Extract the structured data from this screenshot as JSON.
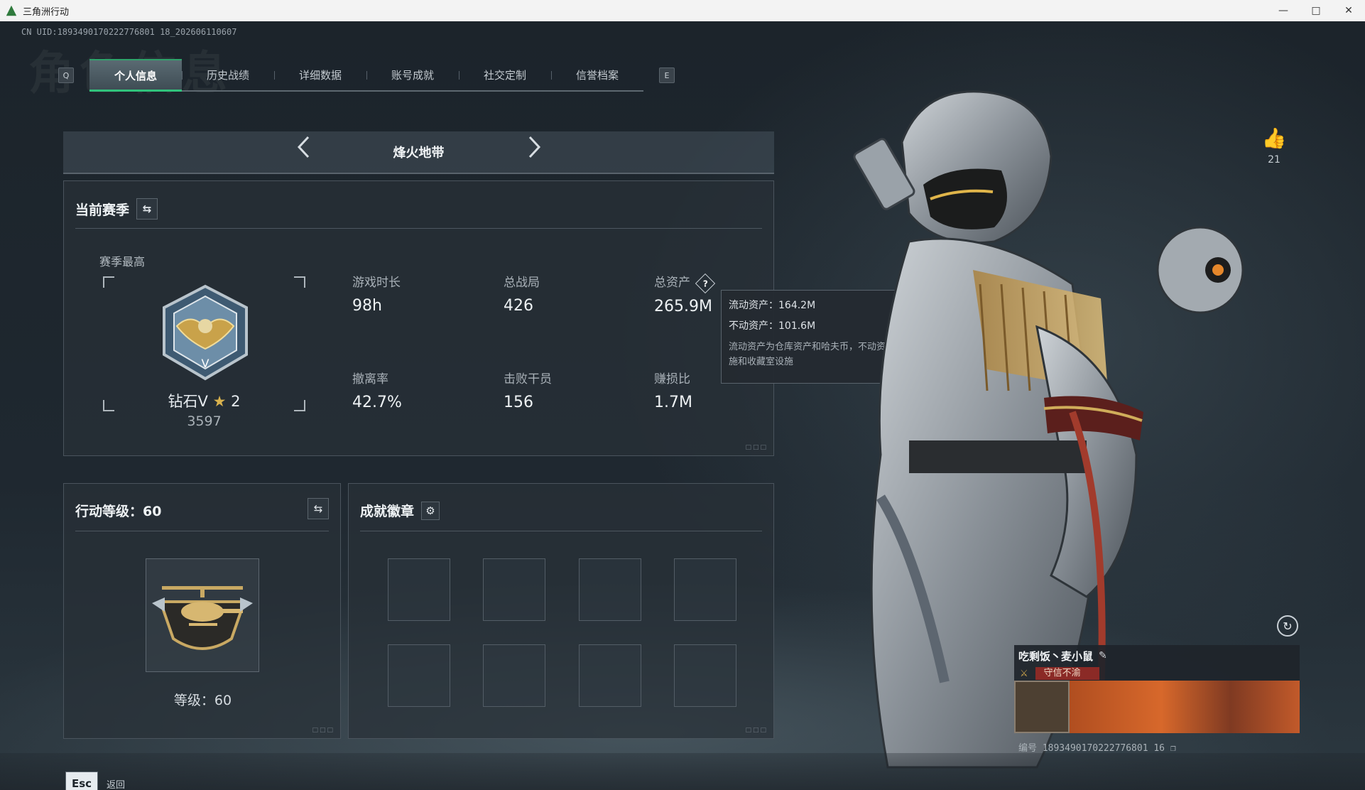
{
  "window": {
    "title": "三角洲行动",
    "controls": [
      "minimize-icon",
      "maximize-icon",
      "close-icon"
    ]
  },
  "uid_line": "CN UID:1893490170222776801 18_202606110607",
  "tabs": {
    "left_key": "Q",
    "right_key": "E",
    "items": [
      "个人信息",
      "历史战绩",
      "详细数据",
      "账号成就",
      "社交定制",
      "信誉档案"
    ],
    "active_index": 0
  },
  "mode": {
    "name": "烽火地带",
    "prev_icon": "chevron-left-icon",
    "next_icon": "chevron-right-icon"
  },
  "season": {
    "title": "当前赛季",
    "swap_icon": "swap-icon",
    "best_label": "赛季最高",
    "rank_name": "钻石V",
    "rank_stars": "2",
    "rank_score": "3597",
    "stats": [
      {
        "label": "游戏时长",
        "value": "98h"
      },
      {
        "label": "总战局",
        "value": "426"
      },
      {
        "label": "总资产",
        "value": "265.9M"
      },
      {
        "label": "撤离率",
        "value": "42.7%"
      },
      {
        "label": "击败干员",
        "value": "156"
      },
      {
        "label": "赚损比",
        "value": "1.7M"
      }
    ]
  },
  "tooltip": {
    "liquid": "流动资产：164.2M",
    "fixed": "不动资产：101.6M",
    "note": "流动资产为仓库资产和哈夫币，不动资产为特勤处设施和收藏室设施"
  },
  "level": {
    "title": "行动等级：60",
    "level_text": "等级：60"
  },
  "achievements": {
    "title": "成就徽章",
    "settings_icon": "gear-icon"
  },
  "profile": {
    "like_count": "21",
    "player_name": "吃剩饭丶麦小鼠",
    "player_title": "守信不渝",
    "id_line": "编号 1893490170222776801 16"
  },
  "footer": {
    "esc_key": "Esc",
    "back_label": "返回"
  }
}
